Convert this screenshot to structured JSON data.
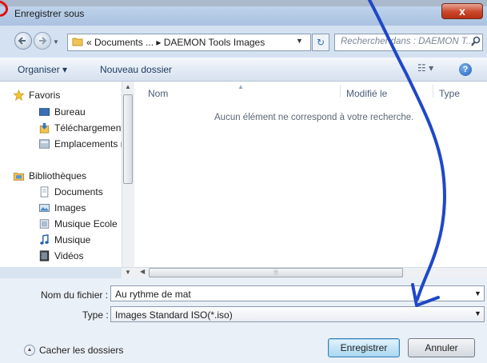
{
  "window": {
    "title": "Enregistrer sous",
    "close_glyph": "x"
  },
  "address": {
    "breadcrumb": "« Documents ... ▸ DAEMON Tools Images",
    "search_placeholder": "Rechercher dans : DAEMON T..."
  },
  "toolbar": {
    "organiser_label": "Organiser ▾",
    "new_folder_label": "Nouveau dossier",
    "view_glyph": "☷ ▾",
    "help_glyph": "?"
  },
  "sidebar": {
    "favorites": {
      "label": "Favoris",
      "icon": "star-icon"
    },
    "favorites_items": [
      {
        "label": "Bureau",
        "icon": "desktop-icon"
      },
      {
        "label": "Téléchargements",
        "icon": "downloads-icon"
      },
      {
        "label": "Emplacements ré",
        "icon": "recent-places-icon"
      }
    ],
    "libraries": {
      "label": "Bibliothèques",
      "icon": "library-icon"
    },
    "libraries_items": [
      {
        "label": "Documents",
        "icon": "document-icon"
      },
      {
        "label": "Images",
        "icon": "pictures-icon"
      },
      {
        "label": "Musique Ecole",
        "icon": "music-library-icon"
      },
      {
        "label": "Musique",
        "icon": "music-note-icon"
      },
      {
        "label": "Vidéos",
        "icon": "video-icon"
      }
    ]
  },
  "filelist": {
    "columns": [
      "Nom",
      "Modifié le",
      "Type"
    ],
    "empty_message": "Aucun élément ne correspond à votre recherche."
  },
  "form": {
    "filename_label": "Nom du fichier :",
    "filename_value": "Au rythme de mat",
    "type_label": "Type :",
    "type_value": "Images Standard ISO(*.iso)"
  },
  "footer": {
    "hide_folders_label": "Cacher les dossiers",
    "save_label": "Enregistrer",
    "cancel_label": "Annuler"
  },
  "colors": {
    "annotation_blue": "#1f48c8",
    "annotation_red": "#e01010",
    "accent_button": "#a9d9f2"
  }
}
